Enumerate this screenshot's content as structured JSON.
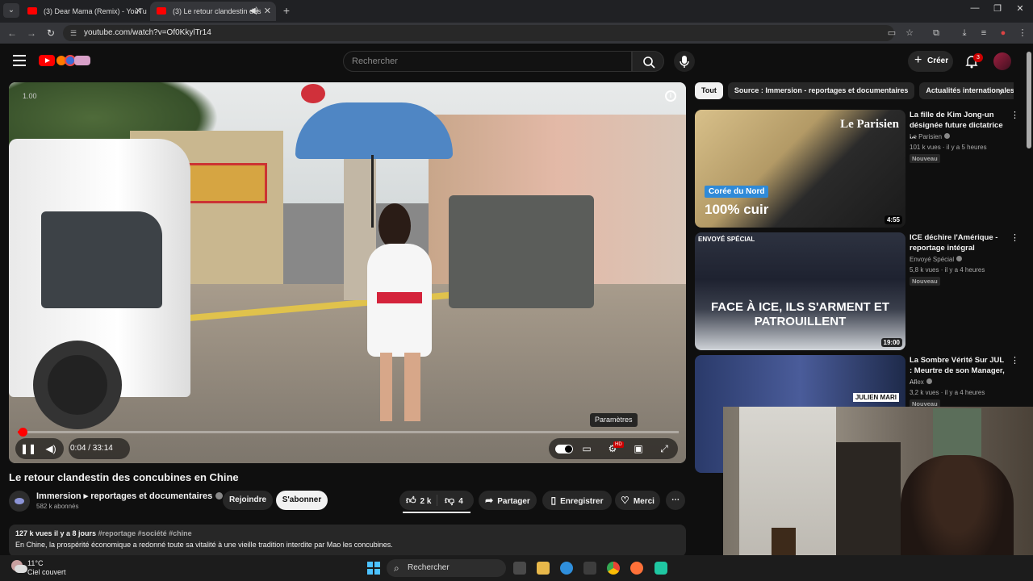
{
  "browser": {
    "tabs": [
      {
        "title": "(3) Dear Mama (Remix) - YouTu"
      },
      {
        "title": "(3) Le retour clandestin des"
      }
    ],
    "url": "youtube.com/watch?v=Of0KkylTr14"
  },
  "header": {
    "search_placeholder": "Rechercher",
    "create_label": "Créer",
    "notification_count": "3"
  },
  "player": {
    "speed": "1.00",
    "time": "0:04 / 33:14",
    "progress_fraction": 0.002,
    "tooltip": "Paramètres"
  },
  "video": {
    "title": "Le retour clandestin des concubines en Chine",
    "channel": "Immersion ▸ reportages et documentaires",
    "subscribers": "582 k abonnés",
    "join_label": "Rejoindre",
    "subscribe_label": "S'abonner",
    "likes": "2 k",
    "dislikes": "4",
    "share_label": "Partager",
    "save_label": "Enregistrer",
    "thanks_label": "Merci",
    "views_date": "127 k vues  il y a 8 jours",
    "tags": "#reportage #société #chine",
    "description": "En Chine, la prospérité économique a redonné toute sa vitalité à une vieille tradition interdite par Mao  les concubines."
  },
  "chips": [
    {
      "label": "Tout"
    },
    {
      "label": "Source : Immersion - reportages et documentaires"
    },
    {
      "label": "Actualités internationales"
    }
  ],
  "recommendations": [
    {
      "title": "La fille de Kim Jong-un désignée future dictatrice ...",
      "channel": "Le Parisien",
      "meta": "101 k vues · il y a 5 heures",
      "badge": "Nouveau",
      "duration": "4:55",
      "overlay_tag": "Corée du Nord",
      "overlay_big": "100% cuir",
      "overlay_brand": "Le Parisien"
    },
    {
      "title": "ICE déchire l'Amérique - reportage intégral",
      "channel": "Envoyé Spécial",
      "meta": "5,8 k vues · il y a 4 heures",
      "badge": "Nouveau",
      "duration": "19:00",
      "overlay_big": "FACE À ICE, ILS S'ARMENT ET PATROUILLENT",
      "overlay_brand": "ENVOYÉ SPÉCIAL"
    },
    {
      "title": "La Sombre Vérité Sur JUL : Meurtre de son Manager, ...",
      "channel": "Aflex",
      "meta": "3,2 k vues · il y a 4 heures",
      "badge": "Nouveau",
      "overlay_brand": "JULIEN MARI"
    }
  ],
  "taskbar": {
    "temperature": "11°C",
    "weather": "Ciel couvert",
    "search_label": "Rechercher"
  },
  "colors": {
    "accent": "#ff0000",
    "background": "#0f0f0f",
    "chip_bg": "#272727"
  }
}
